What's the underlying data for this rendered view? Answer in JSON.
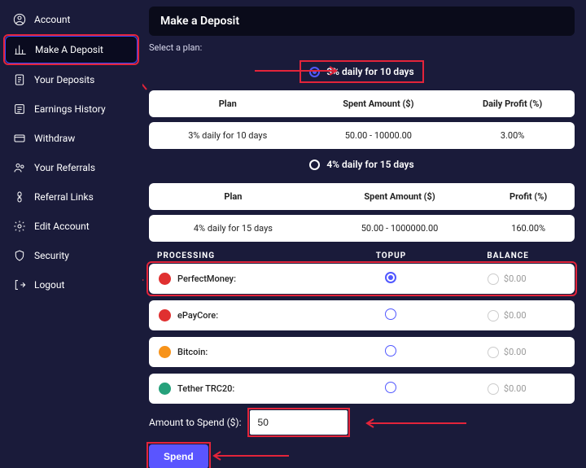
{
  "sidebar": {
    "items": [
      {
        "label": "Account",
        "name": "sidebar-item-account"
      },
      {
        "label": "Make A Deposit",
        "name": "sidebar-item-make-deposit",
        "active": true
      },
      {
        "label": "Your Deposits",
        "name": "sidebar-item-your-deposits"
      },
      {
        "label": "Earnings History",
        "name": "sidebar-item-earnings-history"
      },
      {
        "label": "Withdraw",
        "name": "sidebar-item-withdraw"
      },
      {
        "label": "Your Referrals",
        "name": "sidebar-item-your-referrals"
      },
      {
        "label": "Referral Links",
        "name": "sidebar-item-referral-links"
      },
      {
        "label": "Edit Account",
        "name": "sidebar-item-edit-account"
      },
      {
        "label": "Security",
        "name": "sidebar-item-security"
      },
      {
        "label": "Logout",
        "name": "sidebar-item-logout"
      }
    ]
  },
  "header": {
    "title": "Make a Deposit",
    "subtitle": "Select a plan:"
  },
  "plans": [
    {
      "radio_label": "3% daily for 10 days",
      "selected": true,
      "headers": {
        "col1": "Plan",
        "col2": "Spent Amount ($)",
        "col3": "Daily Profit (%)"
      },
      "row": {
        "col1": "3% daily for 10 days",
        "col2": "50.00 - 10000.00",
        "col3": "3.00%"
      }
    },
    {
      "radio_label": "4% daily for 15 days",
      "selected": false,
      "headers": {
        "col1": "Plan",
        "col2": "Spent Amount ($)",
        "col3": "Profit (%)"
      },
      "row": {
        "col1": "4% daily for 15 days",
        "col2": "50.00 - 1000000.00",
        "col3": "160.00%"
      }
    }
  ],
  "processing": {
    "headers": {
      "col1": "PROCESSING",
      "col2": "TOPUP",
      "col3": "BALANCE"
    },
    "items": [
      {
        "name": "PerfectMoney:",
        "icon_color": "#e03030",
        "selected": true,
        "balance": "$0.00"
      },
      {
        "name": "ePayCore:",
        "icon_color": "#e03030",
        "selected": false,
        "balance": "$0.00"
      },
      {
        "name": "Bitcoin:",
        "icon_color": "#f7931a",
        "selected": false,
        "balance": "$0.00"
      },
      {
        "name": "Tether TRC20:",
        "icon_color": "#26a17b",
        "selected": false,
        "balance": "$0.00"
      }
    ]
  },
  "amount": {
    "label": "Amount to Spend ($):",
    "value": "50"
  },
  "actions": {
    "spend_label": "Spend"
  },
  "colors": {
    "accent": "#5a55ff",
    "highlight": "#e3243a"
  }
}
